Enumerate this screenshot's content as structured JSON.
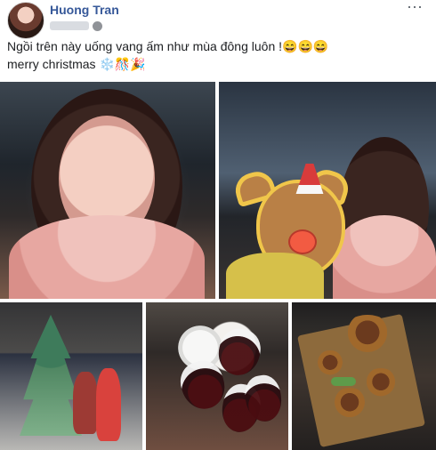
{
  "post": {
    "author": "Huong Tran",
    "timestamp": "",
    "caption": "Ngồi trên này uống vang ấm như mùa đông luôn !😄😄😄\nmerry christmas ❄️🎊🎉",
    "menu_icon": "⋯",
    "visibility_icon": "globe-icon"
  },
  "photos": [
    {
      "label": "woman-portrait"
    },
    {
      "label": "reindeer-selfie"
    },
    {
      "label": "christmas-tree"
    },
    {
      "label": "wine-toast"
    },
    {
      "label": "food-platter"
    }
  ]
}
